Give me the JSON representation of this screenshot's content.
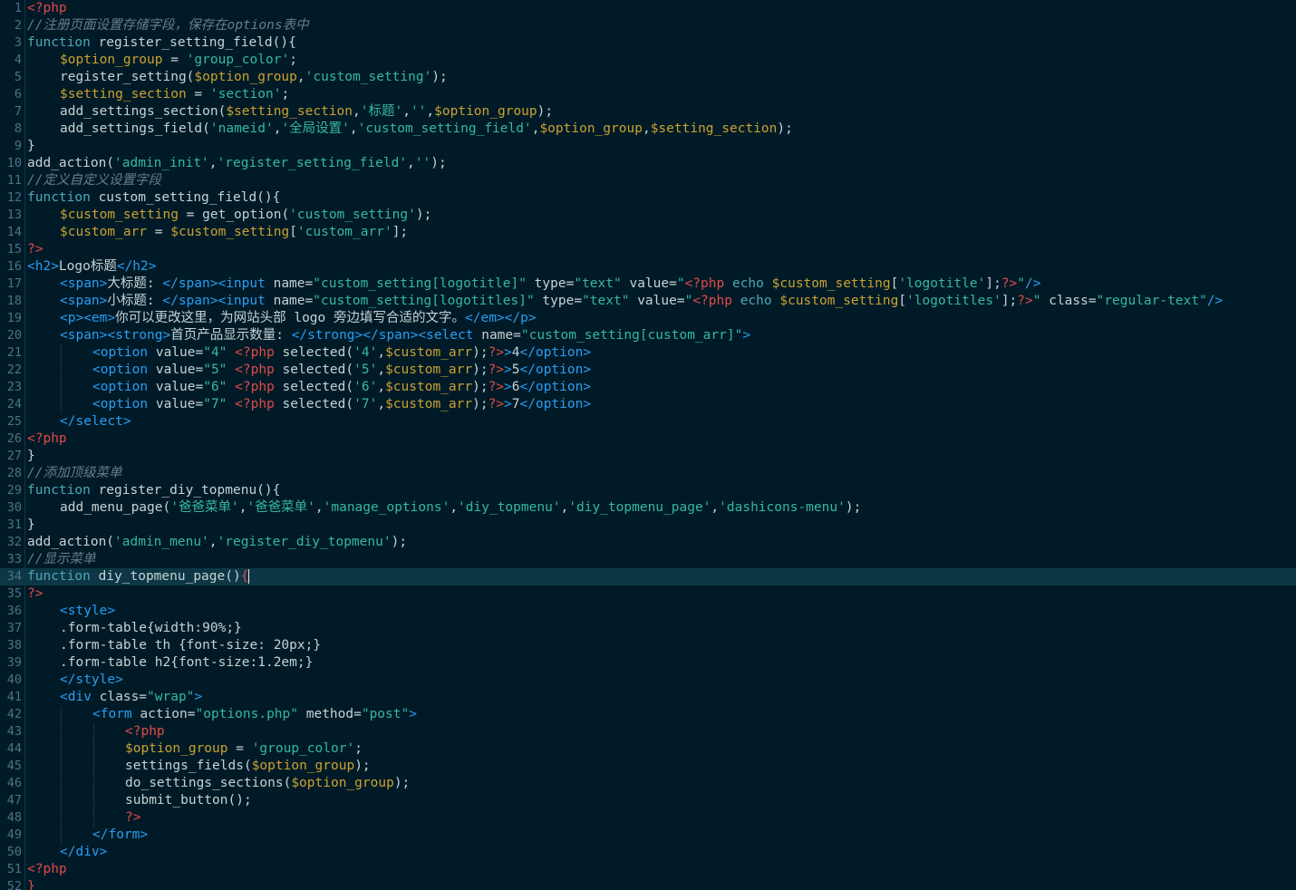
{
  "editor": {
    "colors": {
      "background": "#001b27",
      "current_line": "#0d3745",
      "plain": "#c5d2d6",
      "keyword": "#4ea8b8",
      "variable": "#c9a132",
      "string": "#36b6a8",
      "comment": "#637f8b",
      "php_tag": "#e04a4a",
      "html_tag": "#2a9df4",
      "line_number": "#4a7384"
    },
    "current_line": 34,
    "lines": [
      {
        "n": "1",
        "indent": 0,
        "tokens": [
          [
            "php",
            "<?php"
          ]
        ]
      },
      {
        "n": "2",
        "indent": 0,
        "tokens": [
          [
            "cm",
            "//注册页面设置存储字段，保存在options表中"
          ]
        ]
      },
      {
        "n": "3",
        "indent": 0,
        "tokens": [
          [
            "kw",
            "function"
          ],
          [
            "pl",
            " register_setting_field(){"
          ]
        ]
      },
      {
        "n": "4",
        "indent": 1,
        "tokens": [
          [
            "var",
            "$option_group"
          ],
          [
            "pl",
            " = "
          ],
          [
            "str",
            "'group_color'"
          ],
          [
            "pl",
            ";"
          ]
        ]
      },
      {
        "n": "5",
        "indent": 1,
        "tokens": [
          [
            "pl",
            "register_setting("
          ],
          [
            "var",
            "$option_group"
          ],
          [
            "pl",
            ","
          ],
          [
            "str",
            "'custom_setting'"
          ],
          [
            "pl",
            ");"
          ]
        ]
      },
      {
        "n": "6",
        "indent": 1,
        "tokens": [
          [
            "var",
            "$setting_section"
          ],
          [
            "pl",
            " = "
          ],
          [
            "str",
            "'section'"
          ],
          [
            "pl",
            ";"
          ]
        ]
      },
      {
        "n": "7",
        "indent": 1,
        "tokens": [
          [
            "pl",
            "add_settings_section("
          ],
          [
            "var",
            "$setting_section"
          ],
          [
            "pl",
            ","
          ],
          [
            "str",
            "'标题'"
          ],
          [
            "pl",
            ","
          ],
          [
            "str",
            "''"
          ],
          [
            "pl",
            ","
          ],
          [
            "var",
            "$option_group"
          ],
          [
            "pl",
            ");"
          ]
        ]
      },
      {
        "n": "8",
        "indent": 1,
        "tokens": [
          [
            "pl",
            "add_settings_field("
          ],
          [
            "str",
            "'nameid'"
          ],
          [
            "pl",
            ","
          ],
          [
            "str",
            "'全局设置'"
          ],
          [
            "pl",
            ","
          ],
          [
            "str",
            "'custom_setting_field'"
          ],
          [
            "pl",
            ","
          ],
          [
            "var",
            "$option_group"
          ],
          [
            "pl",
            ","
          ],
          [
            "var",
            "$setting_section"
          ],
          [
            "pl",
            ");"
          ]
        ]
      },
      {
        "n": "9",
        "indent": 0,
        "tokens": [
          [
            "pl",
            "}"
          ]
        ]
      },
      {
        "n": "10",
        "indent": 0,
        "tokens": [
          [
            "pl",
            "add_action("
          ],
          [
            "str",
            "'admin_init'"
          ],
          [
            "pl",
            ","
          ],
          [
            "str",
            "'register_setting_field'"
          ],
          [
            "pl",
            ","
          ],
          [
            "str",
            "''"
          ],
          [
            "pl",
            ");"
          ]
        ]
      },
      {
        "n": "11",
        "indent": 0,
        "tokens": [
          [
            "cm",
            "//定义自定义设置字段"
          ]
        ]
      },
      {
        "n": "12",
        "indent": 0,
        "tokens": [
          [
            "kw",
            "function"
          ],
          [
            "pl",
            " custom_setting_field(){"
          ]
        ]
      },
      {
        "n": "13",
        "indent": 1,
        "tokens": [
          [
            "var",
            "$custom_setting"
          ],
          [
            "pl",
            " = get_option("
          ],
          [
            "str",
            "'custom_setting'"
          ],
          [
            "pl",
            ");"
          ]
        ]
      },
      {
        "n": "14",
        "indent": 1,
        "tokens": [
          [
            "var",
            "$custom_arr"
          ],
          [
            "pl",
            " = "
          ],
          [
            "var",
            "$custom_setting"
          ],
          [
            "pl",
            "["
          ],
          [
            "str",
            "'custom_arr'"
          ],
          [
            "pl",
            "];"
          ]
        ]
      },
      {
        "n": "15",
        "indent": 0,
        "tokens": [
          [
            "php",
            "?>"
          ]
        ]
      },
      {
        "n": "16",
        "indent": 0,
        "tokens": [
          [
            "tag",
            "<h2>"
          ],
          [
            "pl",
            "Logo标题"
          ],
          [
            "tag",
            "</h2>"
          ]
        ]
      },
      {
        "n": "17",
        "indent": 1,
        "tokens": [
          [
            "tag",
            "<span>"
          ],
          [
            "pl",
            "大标题: "
          ],
          [
            "tag",
            "</span><input"
          ],
          [
            "pl",
            " name="
          ],
          [
            "str",
            "\"custom_setting[logotitle]\""
          ],
          [
            "pl",
            " type="
          ],
          [
            "str",
            "\"text\""
          ],
          [
            "pl",
            " value="
          ],
          [
            "str",
            "\""
          ],
          [
            "php",
            "<?php"
          ],
          [
            "kw",
            " echo "
          ],
          [
            "var",
            "$custom_setting"
          ],
          [
            "pl",
            "["
          ],
          [
            "str",
            "'logotitle'"
          ],
          [
            "pl",
            "];"
          ],
          [
            "php",
            "?>"
          ],
          [
            "str",
            "\""
          ],
          [
            "tag",
            "/>"
          ]
        ]
      },
      {
        "n": "18",
        "indent": 1,
        "tokens": [
          [
            "tag",
            "<span>"
          ],
          [
            "pl",
            "小标题: "
          ],
          [
            "tag",
            "</span><input"
          ],
          [
            "pl",
            " name="
          ],
          [
            "str",
            "\"custom_setting[logotitles]\""
          ],
          [
            "pl",
            " type="
          ],
          [
            "str",
            "\"text\""
          ],
          [
            "pl",
            " value="
          ],
          [
            "str",
            "\""
          ],
          [
            "php",
            "<?php"
          ],
          [
            "kw",
            " echo "
          ],
          [
            "var",
            "$custom_setting"
          ],
          [
            "pl",
            "["
          ],
          [
            "str",
            "'logotitles'"
          ],
          [
            "pl",
            "];"
          ],
          [
            "php",
            "?>"
          ],
          [
            "str",
            "\""
          ],
          [
            "pl",
            " class="
          ],
          [
            "str",
            "\"regular-text\""
          ],
          [
            "tag",
            "/>"
          ]
        ]
      },
      {
        "n": "19",
        "indent": 1,
        "tokens": [
          [
            "tag",
            "<p><em>"
          ],
          [
            "pl",
            "你可以更改这里，为网站头部 logo 旁边填写合适的文字。"
          ],
          [
            "tag",
            "</em></p>"
          ]
        ]
      },
      {
        "n": "20",
        "indent": 1,
        "tokens": [
          [
            "tag",
            "<span><strong>"
          ],
          [
            "pl",
            "首页产品显示数量: "
          ],
          [
            "tag",
            "</strong></span><select"
          ],
          [
            "pl",
            " name="
          ],
          [
            "str",
            "\"custom_setting[custom_arr]\""
          ],
          [
            "tag",
            ">"
          ]
        ]
      },
      {
        "n": "21",
        "indent": 2,
        "tokens": [
          [
            "tag",
            "<option"
          ],
          [
            "pl",
            " value="
          ],
          [
            "str",
            "\"4\""
          ],
          [
            "pl",
            " "
          ],
          [
            "php",
            "<?php"
          ],
          [
            "pl",
            " selected("
          ],
          [
            "str",
            "'4'"
          ],
          [
            "pl",
            ","
          ],
          [
            "var",
            "$custom_arr"
          ],
          [
            "pl",
            ");"
          ],
          [
            "php",
            "?>"
          ],
          [
            "tag",
            ">"
          ],
          [
            "pl",
            "4"
          ],
          [
            "tag",
            "</option>"
          ]
        ]
      },
      {
        "n": "22",
        "indent": 2,
        "tokens": [
          [
            "tag",
            "<option"
          ],
          [
            "pl",
            " value="
          ],
          [
            "str",
            "\"5\""
          ],
          [
            "pl",
            " "
          ],
          [
            "php",
            "<?php"
          ],
          [
            "pl",
            " selected("
          ],
          [
            "str",
            "'5'"
          ],
          [
            "pl",
            ","
          ],
          [
            "var",
            "$custom_arr"
          ],
          [
            "pl",
            ");"
          ],
          [
            "php",
            "?>"
          ],
          [
            "tag",
            ">"
          ],
          [
            "pl",
            "5"
          ],
          [
            "tag",
            "</option>"
          ]
        ]
      },
      {
        "n": "23",
        "indent": 2,
        "tokens": [
          [
            "tag",
            "<option"
          ],
          [
            "pl",
            " value="
          ],
          [
            "str",
            "\"6\""
          ],
          [
            "pl",
            " "
          ],
          [
            "php",
            "<?php"
          ],
          [
            "pl",
            " selected("
          ],
          [
            "str",
            "'6'"
          ],
          [
            "pl",
            ","
          ],
          [
            "var",
            "$custom_arr"
          ],
          [
            "pl",
            ");"
          ],
          [
            "php",
            "?>"
          ],
          [
            "tag",
            ">"
          ],
          [
            "pl",
            "6"
          ],
          [
            "tag",
            "</option>"
          ]
        ]
      },
      {
        "n": "24",
        "indent": 2,
        "tokens": [
          [
            "tag",
            "<option"
          ],
          [
            "pl",
            " value="
          ],
          [
            "str",
            "\"7\""
          ],
          [
            "pl",
            " "
          ],
          [
            "php",
            "<?php"
          ],
          [
            "pl",
            " selected("
          ],
          [
            "str",
            "'7'"
          ],
          [
            "pl",
            ","
          ],
          [
            "var",
            "$custom_arr"
          ],
          [
            "pl",
            ");"
          ],
          [
            "php",
            "?>"
          ],
          [
            "tag",
            ">"
          ],
          [
            "pl",
            "7"
          ],
          [
            "tag",
            "</option>"
          ]
        ]
      },
      {
        "n": "25",
        "indent": 1,
        "tokens": [
          [
            "tag",
            "</select>"
          ]
        ]
      },
      {
        "n": "26",
        "indent": 0,
        "tokens": [
          [
            "php",
            "<?php"
          ]
        ]
      },
      {
        "n": "27",
        "indent": 0,
        "tokens": [
          [
            "pl",
            "}"
          ]
        ]
      },
      {
        "n": "28",
        "indent": 0,
        "tokens": [
          [
            "cm",
            "//添加顶级菜单"
          ]
        ]
      },
      {
        "n": "29",
        "indent": 0,
        "tokens": [
          [
            "kw",
            "function"
          ],
          [
            "pl",
            " register_diy_topmenu(){"
          ]
        ]
      },
      {
        "n": "30",
        "indent": 1,
        "tokens": [
          [
            "pl",
            "add_menu_page("
          ],
          [
            "str",
            "'爸爸菜单'"
          ],
          [
            "pl",
            ","
          ],
          [
            "str",
            "'爸爸菜单'"
          ],
          [
            "pl",
            ","
          ],
          [
            "str",
            "'manage_options'"
          ],
          [
            "pl",
            ","
          ],
          [
            "str",
            "'diy_topmenu'"
          ],
          [
            "pl",
            ","
          ],
          [
            "str",
            "'diy_topmenu_page'"
          ],
          [
            "pl",
            ","
          ],
          [
            "str",
            "'dashicons-menu'"
          ],
          [
            "pl",
            ");"
          ]
        ]
      },
      {
        "n": "31",
        "indent": 0,
        "tokens": [
          [
            "pl",
            "}"
          ]
        ]
      },
      {
        "n": "32",
        "indent": 0,
        "tokens": [
          [
            "pl",
            "add_action("
          ],
          [
            "str",
            "'admin_menu'"
          ],
          [
            "pl",
            ","
          ],
          [
            "str",
            "'register_diy_topmenu'"
          ],
          [
            "pl",
            ");"
          ]
        ]
      },
      {
        "n": "33",
        "indent": 0,
        "tokens": [
          [
            "cm",
            "//显示菜单"
          ]
        ]
      },
      {
        "n": "34",
        "indent": 0,
        "tokens": [
          [
            "kw",
            "function"
          ],
          [
            "pl",
            " diy_topmenu_page()"
          ],
          [
            "php",
            "{"
          ]
        ]
      },
      {
        "n": "35",
        "indent": 0,
        "tokens": [
          [
            "php",
            "?>"
          ]
        ]
      },
      {
        "n": "36",
        "indent": 1,
        "tokens": [
          [
            "tag",
            "<style>"
          ]
        ]
      },
      {
        "n": "37",
        "indent": 1,
        "tokens": [
          [
            "pl",
            ".form-table{width:90%;}"
          ]
        ]
      },
      {
        "n": "38",
        "indent": 1,
        "tokens": [
          [
            "pl",
            ".form-table th {font-size: 20px;}"
          ]
        ]
      },
      {
        "n": "39",
        "indent": 1,
        "tokens": [
          [
            "pl",
            ".form-table h2{font-size:1.2em;}"
          ]
        ]
      },
      {
        "n": "40",
        "indent": 1,
        "tokens": [
          [
            "tag",
            "</style>"
          ]
        ]
      },
      {
        "n": "41",
        "indent": 1,
        "tokens": [
          [
            "tag",
            "<div"
          ],
          [
            "pl",
            " class="
          ],
          [
            "str",
            "\"wrap\""
          ],
          [
            "tag",
            ">"
          ]
        ]
      },
      {
        "n": "42",
        "indent": 2,
        "tokens": [
          [
            "tag",
            "<form"
          ],
          [
            "pl",
            " action="
          ],
          [
            "str",
            "\"options.php\""
          ],
          [
            "pl",
            " method="
          ],
          [
            "str",
            "\"post\""
          ],
          [
            "tag",
            ">"
          ]
        ]
      },
      {
        "n": "43",
        "indent": 3,
        "tokens": [
          [
            "php",
            "<?php"
          ]
        ]
      },
      {
        "n": "44",
        "indent": 3,
        "tokens": [
          [
            "var",
            "$option_group"
          ],
          [
            "pl",
            " = "
          ],
          [
            "str",
            "'group_color'"
          ],
          [
            "pl",
            ";"
          ]
        ]
      },
      {
        "n": "45",
        "indent": 3,
        "tokens": [
          [
            "pl",
            "settings_fields("
          ],
          [
            "var",
            "$option_group"
          ],
          [
            "pl",
            ");"
          ]
        ]
      },
      {
        "n": "46",
        "indent": 3,
        "tokens": [
          [
            "pl",
            "do_settings_sections("
          ],
          [
            "var",
            "$option_group"
          ],
          [
            "pl",
            ");"
          ]
        ]
      },
      {
        "n": "47",
        "indent": 3,
        "tokens": [
          [
            "pl",
            "submit_button();"
          ]
        ]
      },
      {
        "n": "48",
        "indent": 3,
        "tokens": [
          [
            "php",
            "?>"
          ]
        ]
      },
      {
        "n": "49",
        "indent": 2,
        "tokens": [
          [
            "tag",
            "</form>"
          ]
        ]
      },
      {
        "n": "50",
        "indent": 1,
        "tokens": [
          [
            "tag",
            "</div>"
          ]
        ]
      },
      {
        "n": "51",
        "indent": 0,
        "tokens": [
          [
            "php",
            "<?php"
          ]
        ]
      },
      {
        "n": "52",
        "indent": 0,
        "tokens": [
          [
            "php",
            "}"
          ]
        ]
      }
    ]
  }
}
